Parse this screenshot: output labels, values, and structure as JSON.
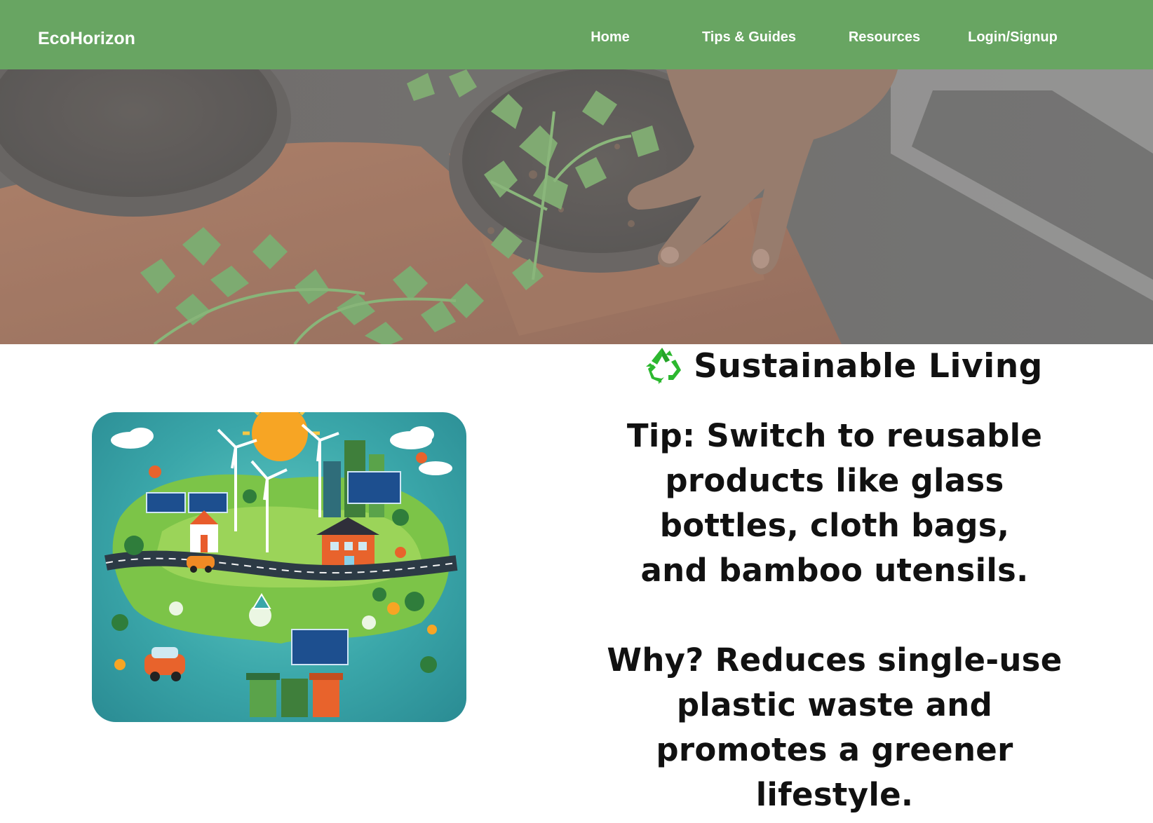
{
  "navbar": {
    "brand": "EcoHorizon",
    "links": [
      {
        "label": "Home"
      },
      {
        "label": "Tips & Guides"
      },
      {
        "label": "Resources"
      },
      {
        "label": "Login/Signup"
      }
    ]
  },
  "colors": {
    "navbar_background": "#68a562",
    "nav_text": "#ffffff",
    "body_text": "#111111",
    "recycle_icon": "#2cb82f"
  },
  "hero": {
    "icon": "hand-planting-seedling-photo"
  },
  "illustration": {
    "icon": "sustainable-city-illustration"
  },
  "section": {
    "icon": "recycle-icon",
    "heading": "Sustainable Living",
    "tip_lines": [
      "Tip: Switch to reusable",
      "products like glass",
      "bottles, cloth bags,",
      "and bamboo utensils."
    ],
    "why_lines": [
      "Why? Reduces single-use",
      "plastic waste and",
      "promotes a greener",
      "lifestyle."
    ]
  }
}
